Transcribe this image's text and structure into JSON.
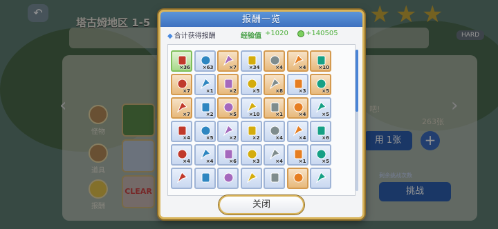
{
  "background": {
    "stage_title": "塔古姆地区 1-5",
    "side_tabs": [
      {
        "label": "怪物"
      },
      {
        "label": "道具"
      },
      {
        "label": "报酬"
      }
    ],
    "right_panel": {
      "note": "吧!",
      "count": "263张",
      "use_button": "用 1张",
      "remaining_label": "剩余挑战次数",
      "challenge_button": "挑战",
      "hard_label": "HARD"
    },
    "clear_stamp": "CLEAR"
  },
  "modal": {
    "title": "报酬一览",
    "summary": {
      "label": "合计获得报酬",
      "exp_label": "经验值",
      "exp_value": "+1020",
      "coin_value": "+140505"
    },
    "items": [
      {
        "qty": "×36",
        "tint": "g"
      },
      {
        "qty": "×63",
        "tint": "b"
      },
      {
        "qty": "×7",
        "tint": "o"
      },
      {
        "qty": "×34",
        "tint": "b"
      },
      {
        "qty": "×4",
        "tint": "o"
      },
      {
        "qty": "×4",
        "tint": "o"
      },
      {
        "qty": "×10",
        "tint": "o"
      },
      {
        "qty": "×7",
        "tint": "o"
      },
      {
        "qty": "×1",
        "tint": "b"
      },
      {
        "qty": "×2",
        "tint": "o"
      },
      {
        "qty": "×5",
        "tint": "b"
      },
      {
        "qty": "×8",
        "tint": "o"
      },
      {
        "qty": "×3",
        "tint": "b"
      },
      {
        "qty": "×5",
        "tint": "o"
      },
      {
        "qty": "×7",
        "tint": "o"
      },
      {
        "qty": "×2",
        "tint": "b"
      },
      {
        "qty": "×5",
        "tint": "o"
      },
      {
        "qty": "×10",
        "tint": "b"
      },
      {
        "qty": "×1",
        "tint": "o"
      },
      {
        "qty": "×4",
        "tint": "o"
      },
      {
        "qty": "×5",
        "tint": "b"
      },
      {
        "qty": "×4",
        "tint": "b"
      },
      {
        "qty": "×5",
        "tint": "b"
      },
      {
        "qty": "×2",
        "tint": "b"
      },
      {
        "qty": "×2",
        "tint": "b"
      },
      {
        "qty": "×4",
        "tint": "b"
      },
      {
        "qty": "×4",
        "tint": "b"
      },
      {
        "qty": "×6",
        "tint": "b"
      },
      {
        "qty": "×4",
        "tint": "b"
      },
      {
        "qty": "×4",
        "tint": "b"
      },
      {
        "qty": "×6",
        "tint": "b"
      },
      {
        "qty": "×3",
        "tint": "b"
      },
      {
        "qty": "×4",
        "tint": "b"
      },
      {
        "qty": "×1",
        "tint": "b"
      },
      {
        "qty": "×5",
        "tint": "b"
      },
      {
        "qty": "",
        "tint": "b"
      },
      {
        "qty": "",
        "tint": "b"
      },
      {
        "qty": "",
        "tint": "b"
      },
      {
        "qty": "",
        "tint": "b"
      },
      {
        "qty": "",
        "tint": "b"
      },
      {
        "qty": "",
        "tint": "o"
      },
      {
        "qty": "",
        "tint": "b"
      }
    ],
    "close_label": "关闭"
  },
  "colors": {
    "header_blue": "#3f72c0",
    "frame_gold": "#d9b45a",
    "exp_green": "#4caf3a"
  }
}
